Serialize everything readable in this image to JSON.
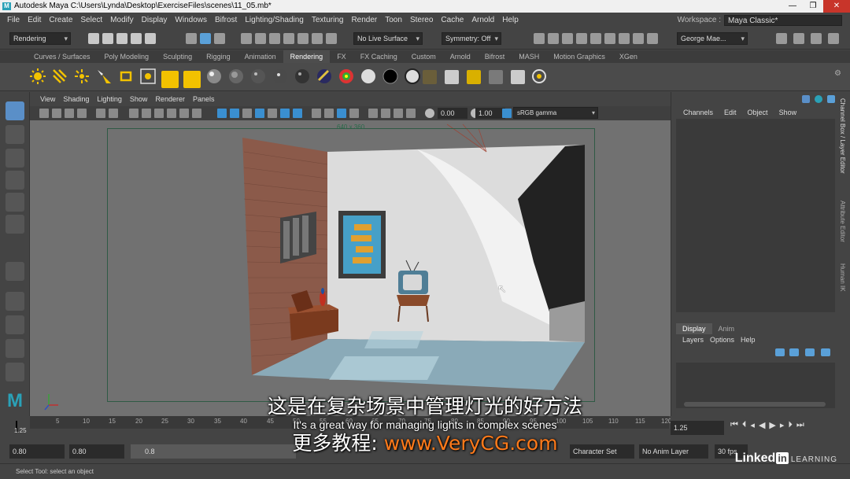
{
  "window": {
    "app_icon": "M",
    "title": "Autodesk Maya  C:\\Users\\Lynda\\Desktop\\ExerciseFiles\\scenes\\11_05.mb*",
    "minimize": "—",
    "maximize": "❐",
    "close": "✕"
  },
  "menubar": {
    "items": [
      "File",
      "Edit",
      "Create",
      "Select",
      "Modify",
      "Display",
      "Windows",
      "Bifrost",
      "Lighting/Shading",
      "Texturing",
      "Render",
      "Toon",
      "Stereo",
      "Cache",
      "Arnold",
      "Help"
    ],
    "workspace_label": "Workspace :",
    "workspace_value": "Maya Classic*"
  },
  "statusline": {
    "menuset": "Rendering",
    "live_surface": "No Live Surface",
    "symmetry": "Symmetry: Off",
    "user": "George Mae..."
  },
  "shelf": {
    "tabs": [
      "Curves / Surfaces",
      "Poly Modeling",
      "Sculpting",
      "Rigging",
      "Animation",
      "Rendering",
      "FX",
      "FX Caching",
      "Custom",
      "Arnold",
      "Bifrost",
      "MASH",
      "Motion Graphics",
      "XGen"
    ],
    "active_tab": "Rendering"
  },
  "viewport": {
    "menus": [
      "View",
      "Shading",
      "Lighting",
      "Show",
      "Renderer",
      "Panels"
    ],
    "exposure": "0.00",
    "gamma": "1.00",
    "color_space": "sRGB gamma",
    "resolution_label": "640 x 360"
  },
  "channelbox": {
    "menus": [
      "Channels",
      "Edit",
      "Object",
      "Show"
    ],
    "side_tabs": [
      "Channel Box / Layer Editor",
      "Attribute Editor",
      "Human IK"
    ],
    "layer_tabs": [
      "Display",
      "Anim"
    ],
    "layer_menus": [
      "Layers",
      "Options",
      "Help"
    ]
  },
  "timeslider": {
    "ticks": [
      "5",
      "10",
      "15",
      "20",
      "25",
      "30",
      "35",
      "40",
      "45",
      "50",
      "55",
      "60",
      "65",
      "70",
      "75",
      "80",
      "85",
      "90",
      "95",
      "100",
      "105",
      "110",
      "115",
      "120"
    ],
    "current_frame": "1.25",
    "current_frame_field": "1.25"
  },
  "rangebar": {
    "start": "0.80",
    "playback_start": "0.80",
    "range_value": "0.8",
    "character_set": "Character Set",
    "anim_layer": "No Anim Layer",
    "fps": "30 fps"
  },
  "helpline": {
    "text": "Select Tool: select an object"
  },
  "subtitles": {
    "chinese": "这是在复杂场景中管理灯光的好方法",
    "english": "It's a great way for managing lights in complex scenes",
    "site_prefix": "更多教程: ",
    "site_url": "www.VeryCG.com"
  },
  "watermark": {
    "linked": "Linked",
    "in": "in",
    "learning": "LEARNING"
  }
}
